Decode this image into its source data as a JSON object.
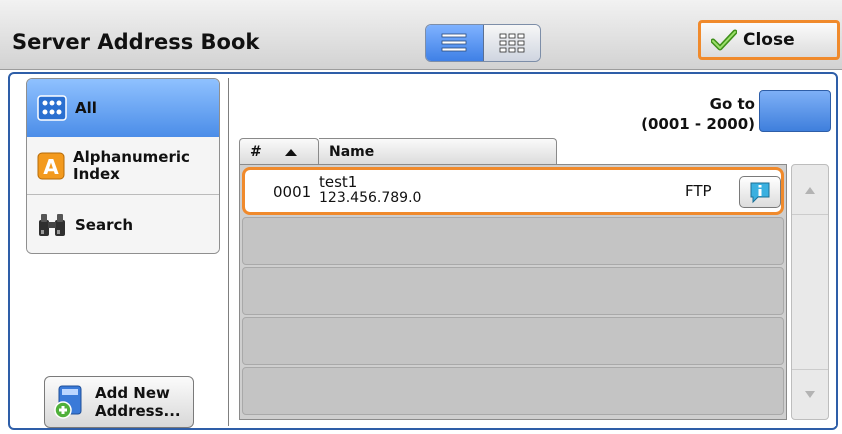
{
  "header": {
    "title": "Server Address Book",
    "close_label": "Close",
    "view_list_icon": "list-view-icon",
    "view_grid_icon": "grid-view-icon"
  },
  "tabs": {
    "all": {
      "label": "All",
      "icon": "address-book-icon"
    },
    "alphanumeric": {
      "label_line1": "Alphanumeric",
      "label_line2": "Index",
      "icon": "letter-a-icon"
    },
    "search": {
      "label": "Search",
      "icon": "binoculars-icon"
    }
  },
  "add_new": {
    "line1": "Add New",
    "line2": "Address...",
    "icon": "add-address-icon"
  },
  "goto": {
    "line1": "Go to",
    "line2": "(0001 - 2000)",
    "value": ""
  },
  "table": {
    "columns": {
      "hash": "#",
      "name": "Name"
    },
    "sort_icon": "sort-ascending-icon",
    "rows": [
      {
        "number": "0001",
        "name": "test1",
        "address": "123.456.789.0",
        "protocol": "FTP",
        "icon": "info-icon"
      }
    ]
  },
  "scroll": {
    "up_icon": "scroll-up-icon",
    "down_icon": "scroll-down-icon"
  },
  "colors": {
    "accent": "#3f80e6",
    "highlight": "#f08a2c",
    "border": "#2e5ea8"
  }
}
